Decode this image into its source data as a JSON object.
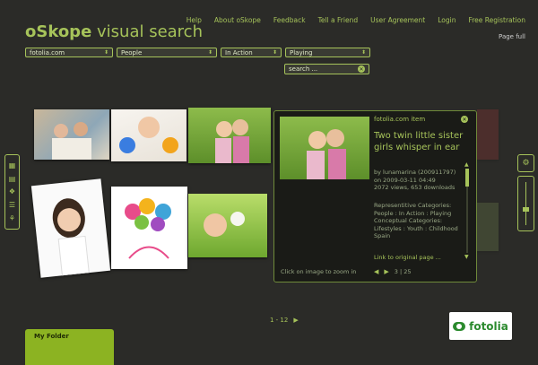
{
  "logo": {
    "brand": "oSkope",
    "rest": " visual search"
  },
  "nav": [
    "Help",
    "About oSkope",
    "Feedback",
    "Tell a Friend",
    "User Agreement",
    "Login",
    "Free Registration"
  ],
  "page_full": "Page full",
  "filters": {
    "source": "fotolia.com",
    "category": "People",
    "subcategory": "In Action",
    "activity": "Playing"
  },
  "search": {
    "placeholder": "search ..."
  },
  "panel": {
    "label": "fotolia.com item",
    "title": "Two twin little sister girls whisper in ear",
    "author": "by lunamarina (200911797)",
    "date": "on 2009-03-11 04:49",
    "stats": "2072 views, 653 downloads",
    "rep_label": "Representitive Categories:",
    "rep_value": "People : In Action : Playing",
    "con_label": "Conceptual Categories:",
    "con_value": "Lifestyles : Youth : Childhood",
    "con_extra": "Spain",
    "link": "Link to original page ...",
    "zoom_hint": "Click on image to zoom in",
    "pager": "3 | 25"
  },
  "pagination": "1 - 12",
  "folder": {
    "label": "My Folder"
  },
  "fotolia": {
    "label": "fotolia"
  },
  "icons": {
    "grid": "grid-icon",
    "grid_small": "grid-small-icon",
    "tree": "tree-icon",
    "list": "list-icon",
    "gear": "gear-icon",
    "close": "close-icon"
  },
  "colors": {
    "accent": "#a6c35a",
    "background": "#2b2b28",
    "folder": "#8cb322"
  }
}
